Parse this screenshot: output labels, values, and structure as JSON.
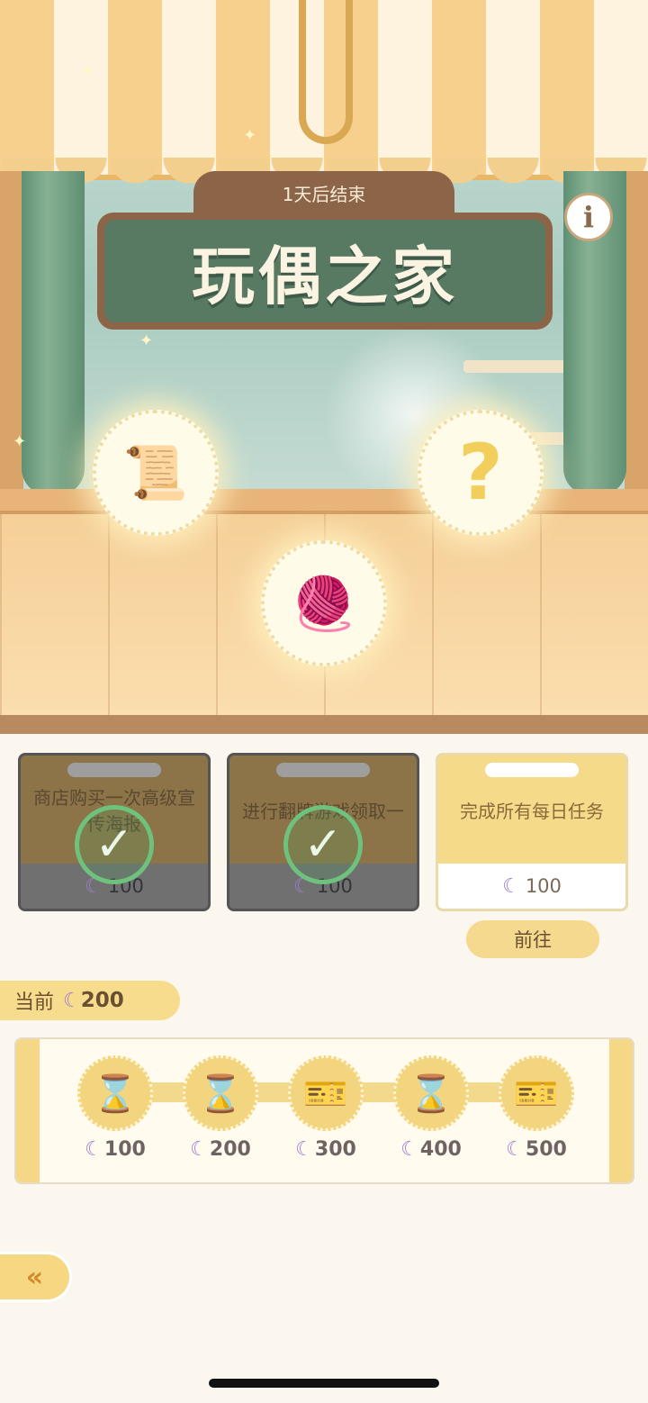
{
  "event": {
    "ends_label": "1天后结束",
    "title": "玩偶之家",
    "info_icon": "i"
  },
  "prizes": [
    {
      "name": "lace-roll-icon",
      "glyph": "📜"
    },
    {
      "name": "question-mark-icon",
      "glyph": "?"
    },
    {
      "name": "pincushion-icon",
      "glyph": "🧶"
    }
  ],
  "tasks": [
    {
      "label": "商店购买一次高级宣传海报",
      "reward": "100",
      "status": "completed"
    },
    {
      "label": "进行翻牌游戏领取一",
      "reward": "100",
      "status": "completed"
    },
    {
      "label": "完成所有每日任务",
      "reward": "100",
      "status": "active"
    }
  ],
  "go_button": "前往",
  "currency_icon": "☾",
  "current": {
    "label": "当前",
    "value": "200"
  },
  "rewards": [
    {
      "icon": "hourglass-icon",
      "glyph": "⌛",
      "cost": "100"
    },
    {
      "icon": "hourglass-icon",
      "glyph": "⌛",
      "cost": "200"
    },
    {
      "icon": "ticket-icon",
      "glyph": "🎫",
      "cost": "300"
    },
    {
      "icon": "hourglass-icon",
      "glyph": "⌛",
      "cost": "400"
    },
    {
      "icon": "ticket-icon",
      "glyph": "🎫",
      "cost": "500"
    }
  ],
  "back_icon": "«"
}
